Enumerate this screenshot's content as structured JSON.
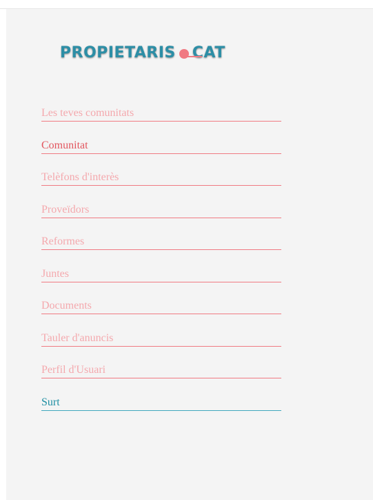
{
  "logo": {
    "left": "PROPIETARIS",
    "right": "CAT"
  },
  "menu": {
    "items": [
      {
        "label": "Les teves comunitats"
      },
      {
        "label": "Comunitat"
      },
      {
        "label": "Telèfons d'interès"
      },
      {
        "label": "Proveïdors"
      },
      {
        "label": "Reformes"
      },
      {
        "label": "Juntes"
      },
      {
        "label": "Documents"
      },
      {
        "label": "Tauler d'anuncis"
      },
      {
        "label": "Perfil d'Usuari"
      },
      {
        "label": "Surt"
      }
    ],
    "active_label": "Comunitat"
  },
  "colors": {
    "brand_blue": "#2c8ea6",
    "brand_coral": "#f07a82",
    "inactive_text": "#f4a8ad",
    "active_text": "#e2555e",
    "logout_text": "#1f8fa3",
    "panel_background": "#f4f4f4"
  }
}
